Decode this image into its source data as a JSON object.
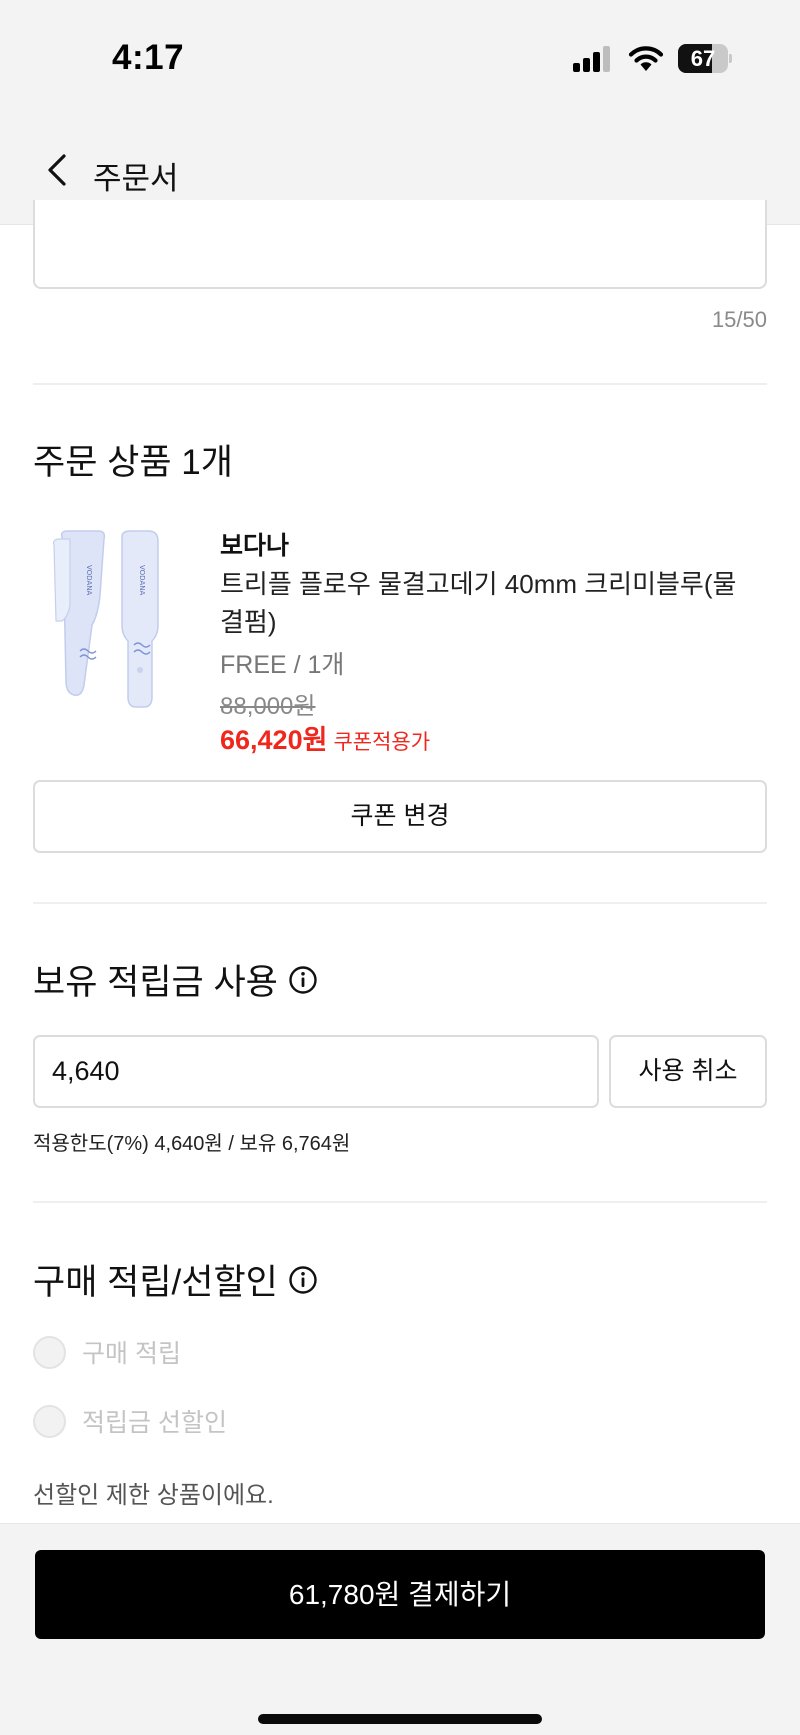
{
  "status_bar": {
    "time": "4:17",
    "battery_level": "67",
    "battery_fraction": 0.67,
    "icons": [
      "signal-icon",
      "wifi-icon",
      "battery-icon"
    ]
  },
  "nav": {
    "back_icon": "chevron-left-icon",
    "title": "주문서"
  },
  "memo": {
    "char_count": "15/50"
  },
  "order_items": {
    "title": "주문 상품 1개",
    "product": {
      "brand": "보다나",
      "name": "트리플 플로우 물결고데기 40mm 크리미블루(물결펌)",
      "option": "FREE / 1개",
      "original_price": "88,000원",
      "sale_price": "66,420원",
      "coupon_note": "쿠폰적용가",
      "image_logo_text": "VODANA"
    },
    "coupon_button": "쿠폰 변경"
  },
  "points": {
    "title": "보유 적립금 사용",
    "info_icon": "info-icon",
    "input_value": "4,640",
    "cancel_button": "사용 취소",
    "limit_text": "적용한도(7%) 4,640원 / 보유 6,764원"
  },
  "reward": {
    "title": "구매 적립/선할인",
    "info_icon": "info-icon",
    "options": [
      "구매 적립",
      "적립금 선할인"
    ],
    "notice": "선할인 제한 상품이에요."
  },
  "checkout": {
    "pay_button": "61,780원 결제하기"
  },
  "colors": {
    "accent_red": "#f0271d",
    "pay_button_bg": "#000000",
    "bar_bg": "#f3f3f3"
  }
}
